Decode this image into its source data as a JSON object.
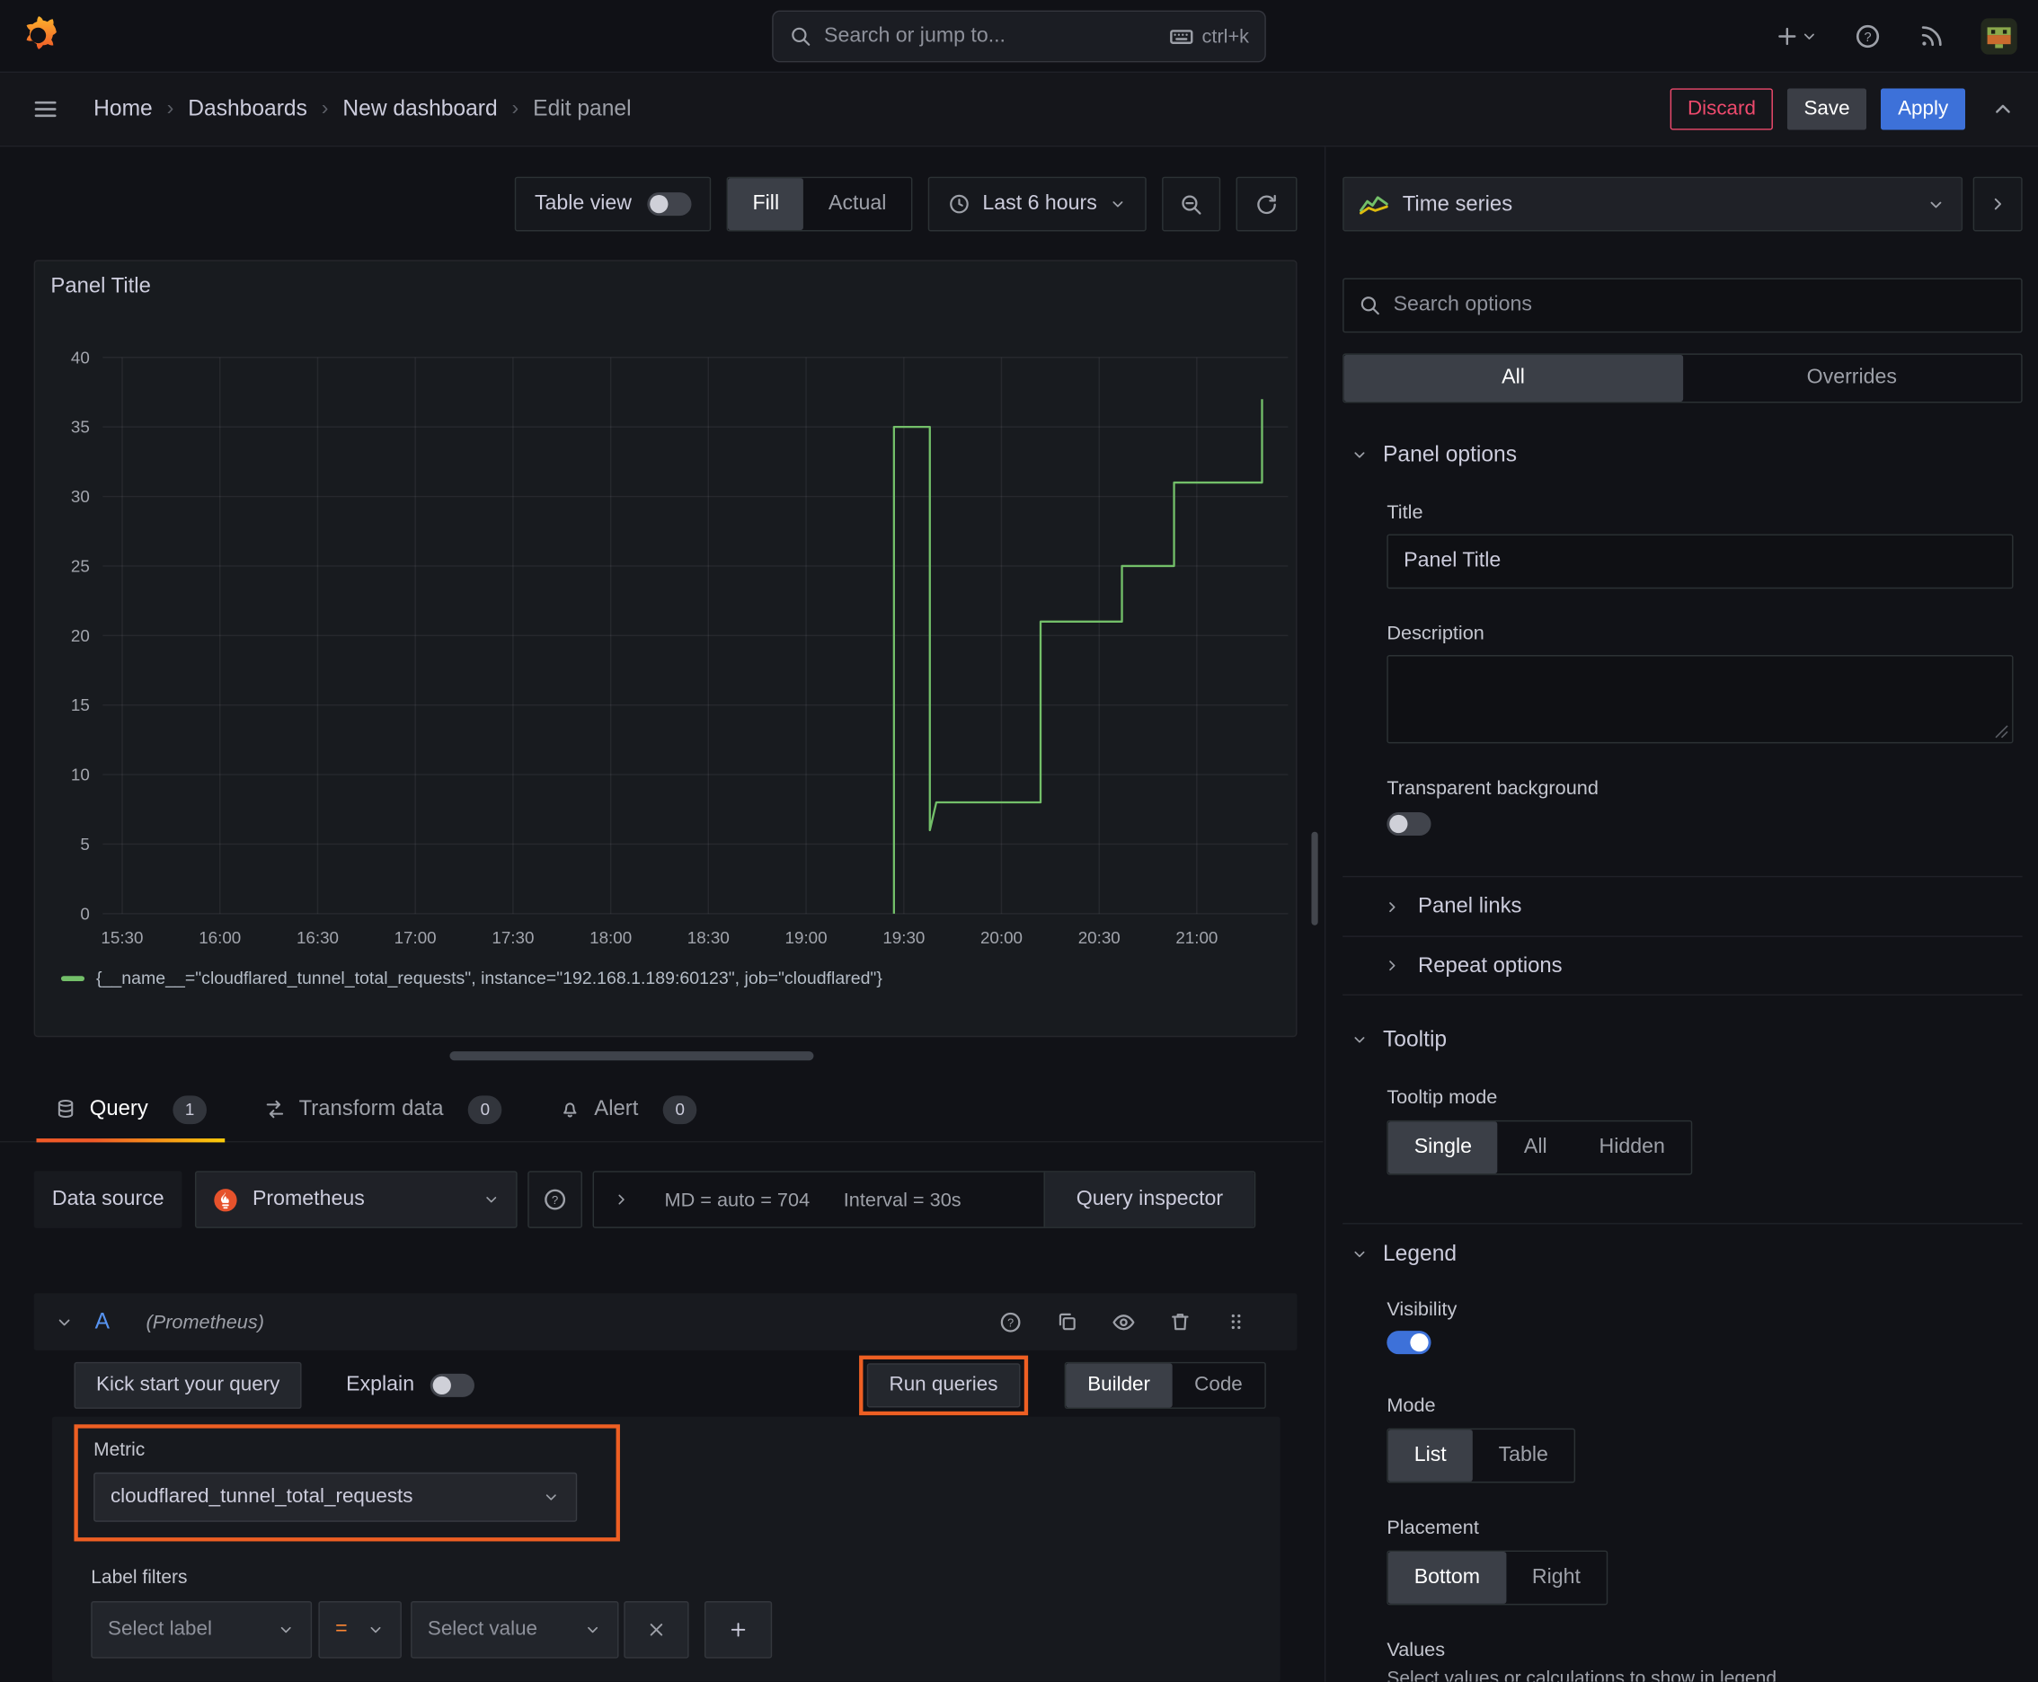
{
  "topbar": {
    "search_placeholder": "Search or jump to...",
    "shortcut": "ctrl+k"
  },
  "breadcrumb": {
    "items": [
      "Home",
      "Dashboards",
      "New dashboard",
      "Edit panel"
    ],
    "separator": "›"
  },
  "actions": {
    "discard": "Discard",
    "save": "Save",
    "apply": "Apply"
  },
  "preview_toolbar": {
    "table_view_label": "Table view",
    "view_modes": [
      "Fill",
      "Actual"
    ],
    "view_mode_selected": "Fill",
    "time_range": "Last 6 hours"
  },
  "panel": {
    "title": "Panel Title"
  },
  "chart_data": {
    "type": "line",
    "line_style": "step",
    "title": "Panel Title",
    "series": [
      {
        "name": "{__name__=\"cloudflared_tunnel_total_requests\", instance=\"192.168.1.189:60123\", job=\"cloudflared\"}",
        "color": "#73bf69",
        "points": [
          [
            "19:27",
            0
          ],
          [
            "19:27",
            35
          ],
          [
            "19:38",
            35
          ],
          [
            "19:38",
            6
          ],
          [
            "19:40",
            8
          ],
          [
            "20:12",
            8
          ],
          [
            "20:12",
            21
          ],
          [
            "20:37",
            21
          ],
          [
            "20:37",
            25
          ],
          [
            "20:53",
            25
          ],
          [
            "20:53",
            31
          ],
          [
            "21:20",
            31
          ],
          [
            "21:20",
            37
          ]
        ]
      }
    ],
    "x_ticks": [
      "15:30",
      "16:00",
      "16:30",
      "17:00",
      "17:30",
      "18:00",
      "18:30",
      "19:00",
      "19:30",
      "20:00",
      "20:30",
      "21:00"
    ],
    "x_range": [
      "15:24",
      "21:28"
    ],
    "y_ticks": [
      0,
      5,
      10,
      15,
      20,
      25,
      30,
      35,
      40
    ],
    "ylim": [
      0,
      40
    ],
    "grid": true,
    "legend_position": "bottom"
  },
  "tabs": [
    {
      "label": "Query",
      "badge": "1",
      "active": true
    },
    {
      "label": "Transform data",
      "badge": "0",
      "active": false
    },
    {
      "label": "Alert",
      "badge": "0",
      "active": false
    }
  ],
  "query": {
    "datasource_label": "Data source",
    "datasource_value": "Prometheus",
    "options_summary_md": "MD = auto = 704",
    "options_summary_interval": "Interval = 30s",
    "inspector_label": "Query inspector",
    "ref_id": "A",
    "ref_note": "(Prometheus)",
    "kick_start_label": "Kick start your query",
    "explain_label": "Explain",
    "run_queries_label": "Run queries",
    "editor_modes": [
      "Builder",
      "Code"
    ],
    "editor_mode_selected": "Builder",
    "metric_label": "Metric",
    "metric_value": "cloudflared_tunnel_total_requests",
    "label_filters_label": "Label filters",
    "select_label_placeholder": "Select label",
    "operator": "=",
    "select_value_placeholder": "Select value"
  },
  "options_pane": {
    "visualization": "Time series",
    "search_placeholder": "Search options",
    "tabs": [
      "All",
      "Overrides"
    ],
    "tab_selected": "All",
    "panel_options": {
      "header": "Panel options",
      "title_label": "Title",
      "title_value": "Panel Title",
      "description_label": "Description",
      "description_value": "",
      "transparent_label": "Transparent background",
      "panel_links": "Panel links",
      "repeat_options": "Repeat options"
    },
    "tooltip": {
      "header": "Tooltip",
      "mode_label": "Tooltip mode",
      "modes": [
        "Single",
        "All",
        "Hidden"
      ],
      "mode_selected": "Single"
    },
    "legend": {
      "header": "Legend",
      "visibility_label": "Visibility",
      "visibility_on": true,
      "mode_label": "Mode",
      "modes": [
        "List",
        "Table"
      ],
      "mode_selected": "List",
      "placement_label": "Placement",
      "placements": [
        "Bottom",
        "Right"
      ],
      "placement_selected": "Bottom",
      "values_label": "Values",
      "values_hint": "Select values or calculations to show in legend"
    }
  },
  "glyphs": {
    "question": "?"
  },
  "colors": {
    "accent_blue": "#3d71d9",
    "brand_orange": "#ff8833",
    "highlight_orange": "#ee5f23",
    "destructive_red": "#ee4a6d",
    "series_green": "#73bf69"
  }
}
